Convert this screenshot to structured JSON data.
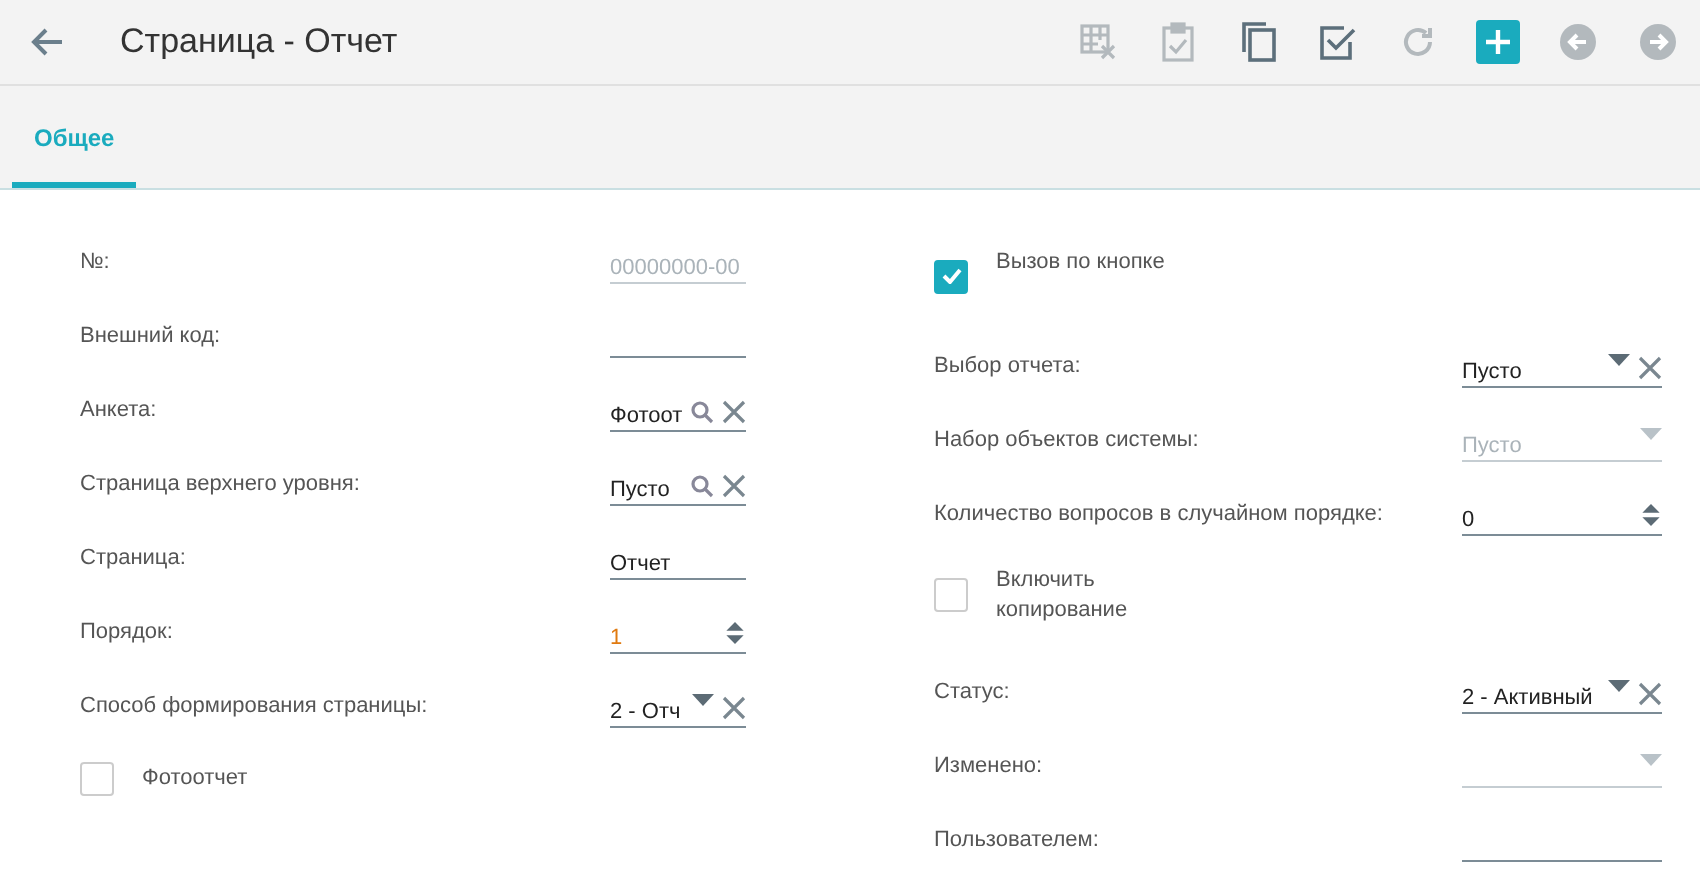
{
  "header": {
    "title": "Страница - Отчет",
    "toolbar": [
      {
        "kind": "table-delete",
        "disabled": true
      },
      {
        "kind": "clipboard-check",
        "disabled": true
      },
      {
        "kind": "copy",
        "disabled": false
      },
      {
        "kind": "check",
        "disabled": false
      },
      {
        "kind": "refresh",
        "disabled": true
      },
      {
        "kind": "add",
        "disabled": false
      },
      {
        "kind": "previous",
        "disabled": true
      },
      {
        "kind": "next",
        "disabled": true
      }
    ]
  },
  "tabs": [
    {
      "label": "Общее",
      "selected": true
    }
  ],
  "left_fields": [
    {
      "kind": "text",
      "label": "№:",
      "value": "00000000-00",
      "disabled": true
    },
    {
      "kind": "text",
      "label": "Внешний код:"
    },
    {
      "kind": "lookup",
      "label": "Анкета:",
      "value": "Фотоот"
    },
    {
      "kind": "lookup",
      "label": "Страница верхнего уровня:",
      "value": "Пусто"
    },
    {
      "kind": "text",
      "label": "Страница:",
      "value": "Отчет",
      "disabled": false
    },
    {
      "kind": "number",
      "label": "Порядок:",
      "value": "1",
      "modified": true
    },
    {
      "kind": "select",
      "label": "Способ формирования страницы:",
      "value": "2 - Отч",
      "clearable": true,
      "disabled": false
    },
    {
      "kind": "checkbox",
      "label": "Фотоотчет",
      "checked": false
    }
  ],
  "right_fields": [
    {
      "kind": "checkbox",
      "label": "Вызов по кнопке",
      "checked": true
    },
    {
      "kind": "select",
      "label": "Выбор отчета:",
      "value": "Пусто",
      "clearable": true,
      "disabled": false
    },
    {
      "kind": "select",
      "label": "Набор объектов системы:",
      "value": "Пусто",
      "clearable": false,
      "disabled": true
    },
    {
      "kind": "number",
      "label": "Количество вопросов в случайном порядке:",
      "value": "0",
      "modified": false
    },
    {
      "kind": "checkbox",
      "label": "Включить копирование",
      "checked": false
    },
    {
      "kind": "select",
      "label": "Статус:",
      "value": "2 - Активный",
      "clearable": true,
      "disabled": false
    },
    {
      "kind": "select",
      "label": "Изменено:",
      "clearable": false,
      "disabled": true
    },
    {
      "kind": "text",
      "label": "Пользователем:"
    }
  ]
}
